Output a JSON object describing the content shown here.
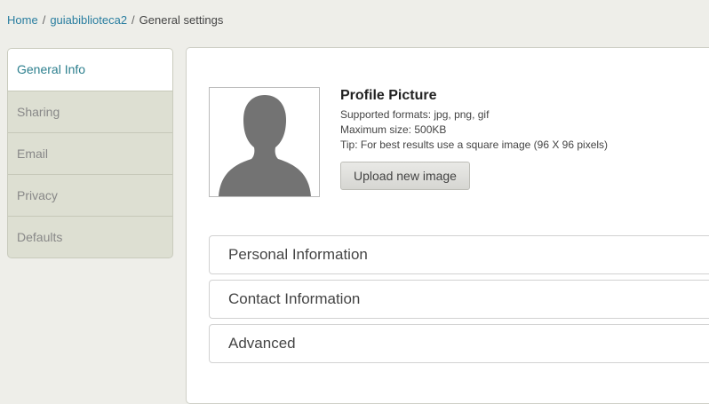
{
  "breadcrumb": {
    "home": "Home",
    "site": "guiabiblioteca2",
    "current": "General settings",
    "separator": "/"
  },
  "sidenav": {
    "items": [
      {
        "label": "General Info",
        "active": true
      },
      {
        "label": "Sharing",
        "active": false
      },
      {
        "label": "Email",
        "active": false
      },
      {
        "label": "Privacy",
        "active": false
      },
      {
        "label": "Defaults",
        "active": false
      }
    ]
  },
  "profile": {
    "title": "Profile Picture",
    "formats": "Supported formats: jpg, png, gif",
    "max_size": "Maximum size: 500KB",
    "tip": "Tip: For best results use a square image (96 X 96 pixels)",
    "upload_label": "Upload new image",
    "avatar_icon": "user-silhouette-icon"
  },
  "sections": [
    {
      "label": "Personal Information"
    },
    {
      "label": "Contact Information"
    },
    {
      "label": "Advanced"
    }
  ],
  "colors": {
    "link": "#2a7ea0",
    "active_tab_text": "#2c7f8e",
    "sidenav_bg": "#dddfd2",
    "page_bg": "#eeeee9"
  }
}
